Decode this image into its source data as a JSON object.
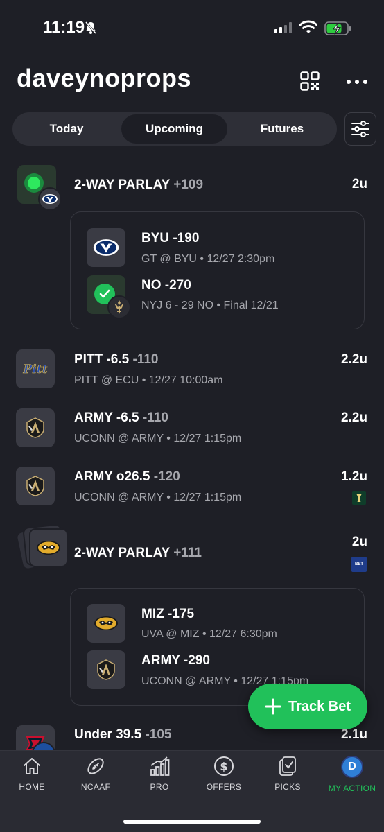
{
  "status_bar": {
    "time": "11:19"
  },
  "header": {
    "title": "daveynoprops"
  },
  "tabs": [
    {
      "label": "Today"
    },
    {
      "label": "Upcoming",
      "active": true
    },
    {
      "label": "Futures"
    }
  ],
  "bets": [
    {
      "title": "2-WAY PARLAY",
      "odds": "+109",
      "units": "2u",
      "legs": [
        {
          "title": "BYU -190",
          "subtitle": "GT @ BYU • 12/27 2:30pm"
        },
        {
          "title": "NO -270",
          "subtitle": "NYJ 6 - 29 NO • Final 12/21"
        }
      ]
    },
    {
      "title": "PITT -6.5",
      "odds": "-110",
      "subtitle": "PITT @ ECU • 12/27 10:00am",
      "units": "2.2u"
    },
    {
      "title": "ARMY -6.5",
      "odds": "-110",
      "subtitle": "UCONN @ ARMY • 12/27 1:15pm",
      "units": "2.2u"
    },
    {
      "title": "ARMY o26.5",
      "odds": "-120",
      "subtitle": "UCONN @ ARMY • 12/27 1:15pm",
      "units": "1.2u"
    },
    {
      "title": "2-WAY PARLAY",
      "odds": "+111",
      "units": "2u",
      "book_badge": "BET",
      "legs": [
        {
          "title": "MIZ -175",
          "subtitle": "UVA @ MIZ • 12/27 6:30pm"
        },
        {
          "title": "ARMY -290",
          "subtitle": "UCONN @ ARMY • 12/27 1:15pm"
        }
      ]
    },
    {
      "title": "Under 39.5",
      "odds": "-105",
      "units": "2.1u"
    }
  ],
  "track_bet": {
    "label": "Track Bet"
  },
  "bottom_nav": [
    {
      "label": "HOME",
      "icon": "home-icon"
    },
    {
      "label": "NCAAF",
      "icon": "football-icon"
    },
    {
      "label": "PRO",
      "icon": "chart-icon"
    },
    {
      "label": "OFFERS",
      "icon": "dollar-icon"
    },
    {
      "label": "PICKS",
      "icon": "picks-icon"
    },
    {
      "label": "MY ACTION",
      "icon": "avatar",
      "avatar_letter": "D",
      "active": true
    }
  ],
  "colors": {
    "accent": "#21c15a",
    "background": "#1e1f26",
    "muted_text": "#a6a7ad"
  }
}
